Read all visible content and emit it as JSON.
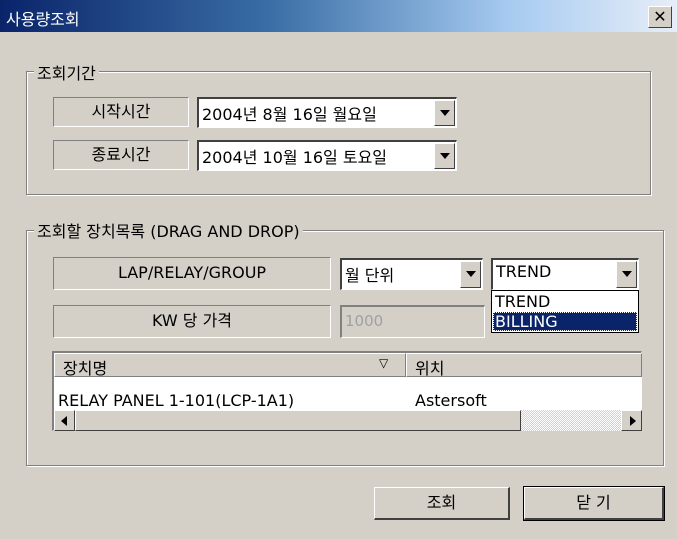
{
  "window": {
    "title": "사용량조회",
    "close_glyph": "✕"
  },
  "period_group": {
    "legend": "조회기간",
    "start_label": "시작시간",
    "start_value": "2004년  8월 16일 월요일",
    "end_label": "종료시간",
    "end_value": "2004년 10월 16일 토요일"
  },
  "device_group": {
    "legend": "조회할 장치목록 (DRAG AND DROP)",
    "lap_label": "LAP/RELAY/GROUP",
    "unit_select_value": "월 단위",
    "mode_select_value": "TREND",
    "mode_options": [
      "TREND",
      "BILLING"
    ],
    "mode_selected_option": "BILLING",
    "price_label": "KW 당 가격",
    "price_value": "1000",
    "table": {
      "columns": [
        "장치명",
        "위치"
      ],
      "sort_glyph": "▽",
      "rows": [
        {
          "name": "RELAY PANEL 1-101(LCP-1A1)",
          "location": "Astersoft"
        }
      ]
    }
  },
  "buttons": {
    "search": "조회",
    "close": "닫 기"
  }
}
